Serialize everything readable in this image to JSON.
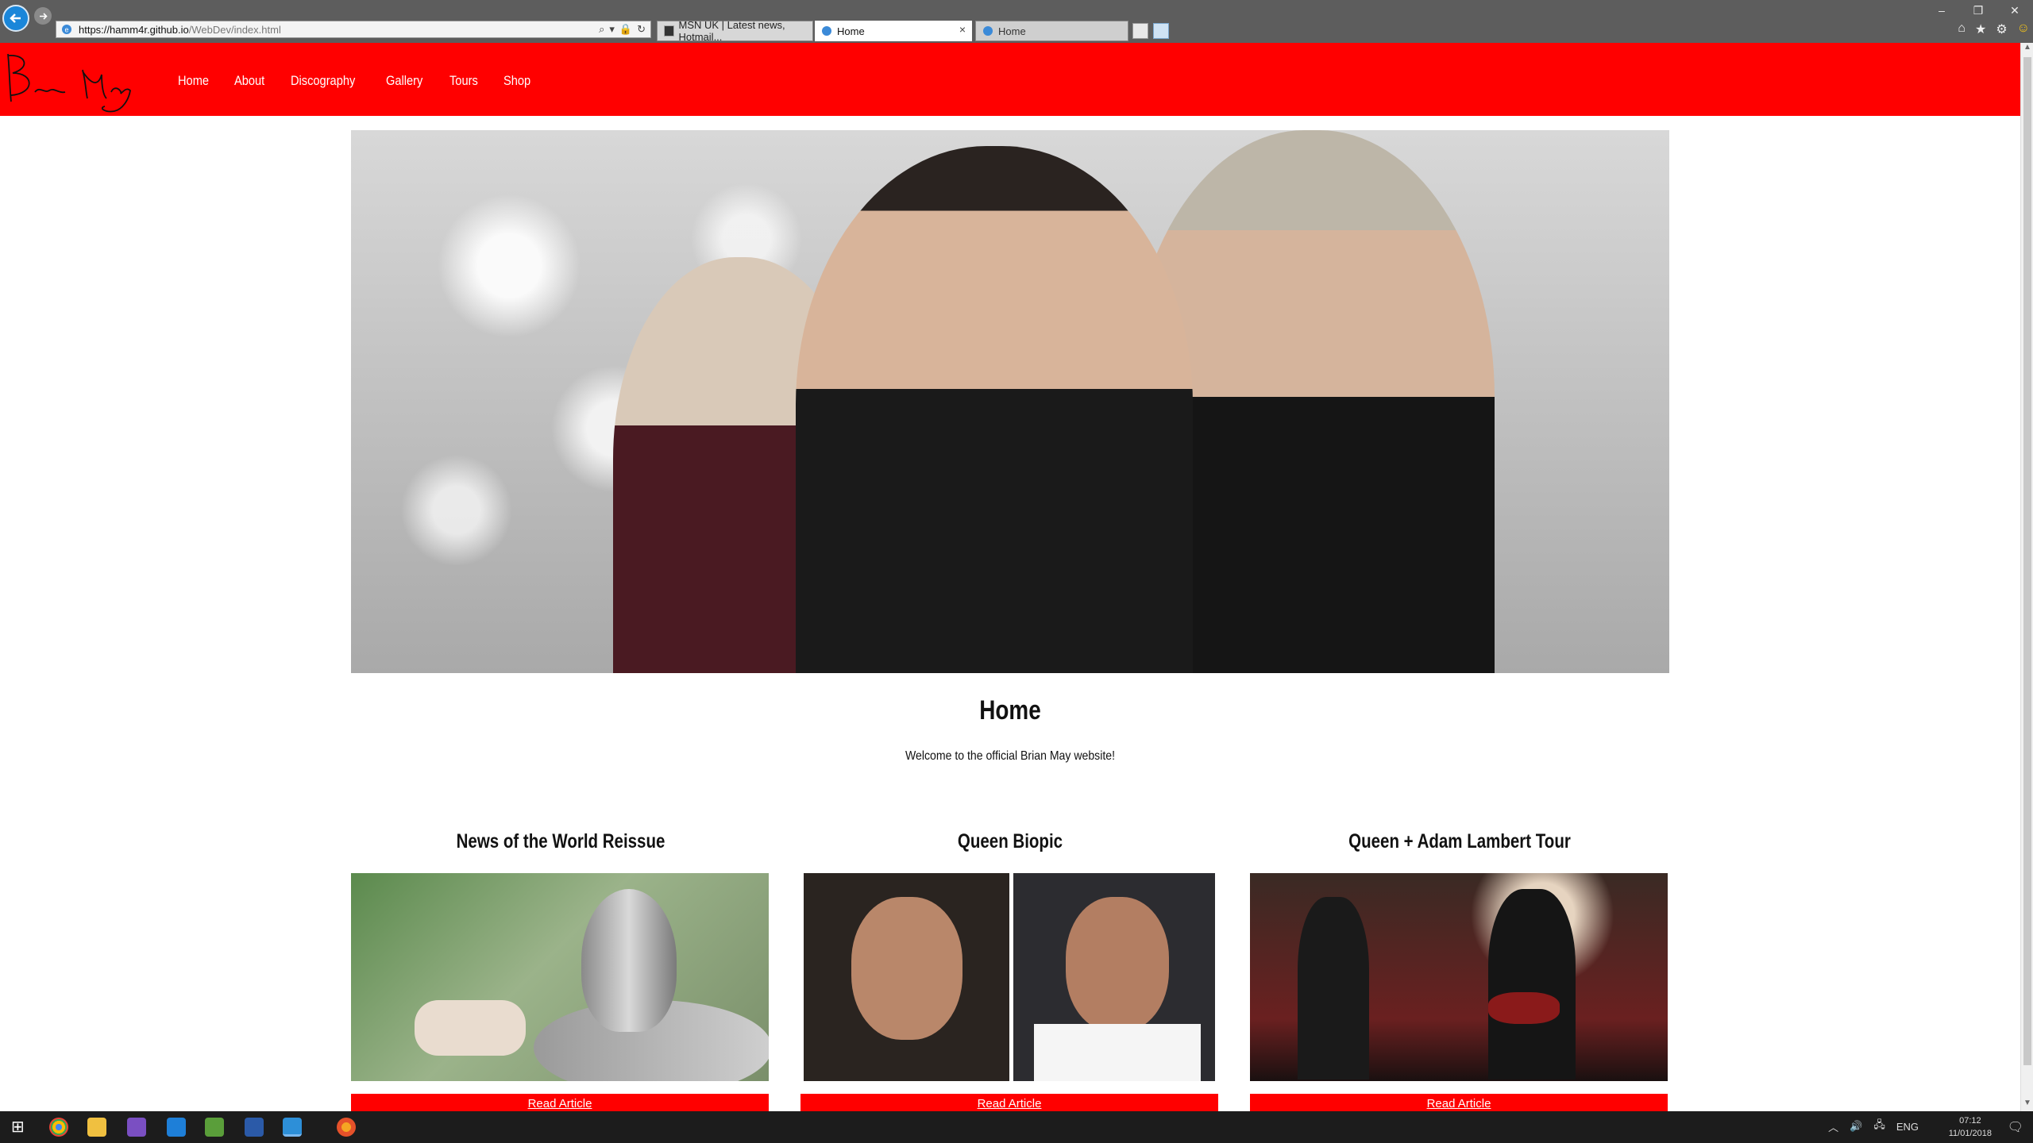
{
  "browser": {
    "url_host": "https://hamm4r.github.io",
    "url_path": "/WebDev/index.html",
    "tabs": [
      {
        "label": "MSN UK | Latest news, Hotmail..."
      },
      {
        "label": "Home"
      },
      {
        "label": "Home"
      }
    ]
  },
  "site": {
    "nav": [
      {
        "label": "Home"
      },
      {
        "label": "About"
      },
      {
        "label": "Discography"
      },
      {
        "label": "Gallery"
      },
      {
        "label": "Tours"
      },
      {
        "label": "Shop"
      }
    ],
    "colors": {
      "accent": "#ff0000"
    }
  },
  "intro": {
    "title": "Home",
    "text": "Welcome to the official Brian May website!"
  },
  "articles": [
    {
      "title": "News of the World Reissue",
      "button": "Read Article"
    },
    {
      "title": "Queen Biopic",
      "button": "Read Article"
    },
    {
      "title": "Queen + Adam Lambert Tour",
      "button": "Read Article"
    }
  ],
  "taskbar": {
    "language": "ENG",
    "time": "07:12",
    "date": "11/01/2018"
  }
}
